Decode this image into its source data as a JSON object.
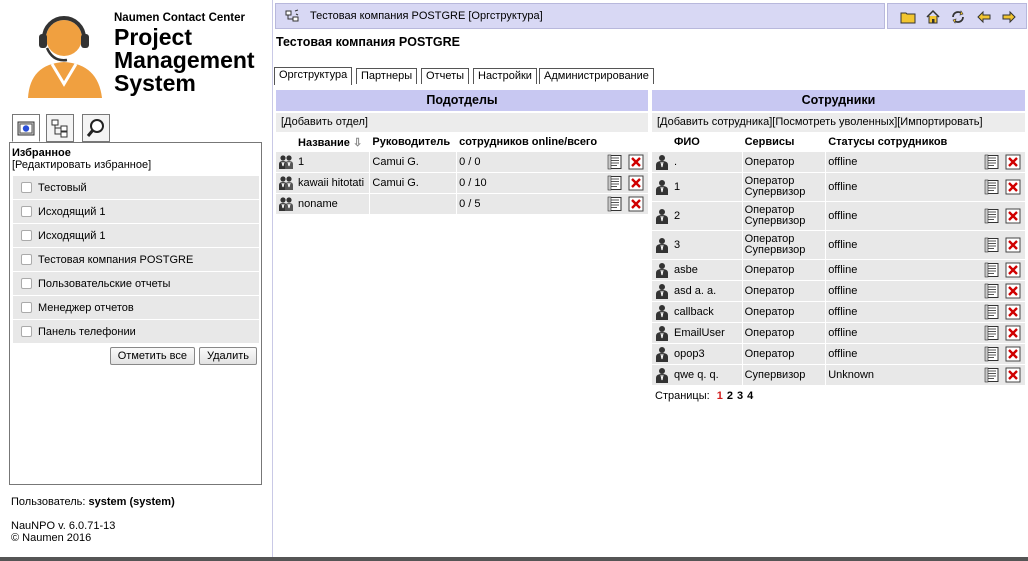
{
  "logo": {
    "company": "Naumen Contact Center",
    "product_line1": "Project",
    "product_line2": "Management",
    "product_line3": "System"
  },
  "favorites": {
    "title": "Избранное",
    "edit_link": "[Редактировать избранное]",
    "items": [
      {
        "label": "Тестовый"
      },
      {
        "label": "Исходящий 1"
      },
      {
        "label": "Исходящий 1"
      },
      {
        "label": "Тестовая компания POSTGRE"
      },
      {
        "label": "Пользовательские отчеты"
      },
      {
        "label": "Менеджер отчетов"
      },
      {
        "label": "Панель телефонии"
      }
    ],
    "mark_all_button": "Отметить все",
    "delete_button": "Удалить"
  },
  "user": {
    "label": "Пользователь:",
    "name": "system (system)"
  },
  "version": {
    "line1": "NauNPO v. 6.0.71-13",
    "line2": "© Naumen 2016"
  },
  "breadcrumb": "Тестовая компания POSTGRE [Оргструктура]",
  "page_title": "Тестовая компания POSTGRE",
  "tabs": [
    {
      "label": "Оргструктура"
    },
    {
      "label": "Партнеры"
    },
    {
      "label": "Отчеты"
    },
    {
      "label": "Настройки"
    },
    {
      "label": "Администрирование"
    }
  ],
  "subdivisions": {
    "title": "Подотделы",
    "add_link": "[Добавить отдел]",
    "columns": [
      "Название",
      "Руководитель",
      "сотрудников online/всего"
    ],
    "rows": [
      {
        "name": "1",
        "head": "Camui G.",
        "count": "0 / 0"
      },
      {
        "name": "kawaii hitotati",
        "head": "Camui G.",
        "count": "0 / 10"
      },
      {
        "name": "noname",
        "head": "",
        "count": "0 / 5"
      }
    ]
  },
  "employees": {
    "title": "Сотрудники",
    "tools_link": "[Добавить сотрудника][Посмотреть уволенных][Импортировать]",
    "columns": [
      "ФИО",
      "Сервисы",
      "Статусы сотрудников"
    ],
    "rows": [
      {
        "name": ".",
        "services1": "Оператор",
        "services2": "",
        "status": "offline"
      },
      {
        "name": "1",
        "services1": "Оператор",
        "services2": "Супервизор",
        "status": "offline"
      },
      {
        "name": "2",
        "services1": "Оператор",
        "services2": "Супервизор",
        "status": "offline"
      },
      {
        "name": "3",
        "services1": "Оператор",
        "services2": "Супервизор",
        "status": "offline"
      },
      {
        "name": "asbe",
        "services1": "Оператор",
        "services2": "",
        "status": "offline"
      },
      {
        "name": "asd a. a.",
        "services1": "Оператор",
        "services2": "",
        "status": "offline"
      },
      {
        "name": "callback",
        "services1": "Оператор",
        "services2": "",
        "status": "offline"
      },
      {
        "name": "EmailUser",
        "services1": "Оператор",
        "services2": "",
        "status": "offline"
      },
      {
        "name": "opop3",
        "services1": "Оператор",
        "services2": "",
        "status": "offline"
      },
      {
        "name": "qwe q. q.",
        "services1": "Супервизор",
        "services2": "",
        "status": "Unknown"
      }
    ],
    "pages_label": "Страницы:",
    "pages": [
      "1",
      "2",
      "3",
      "4"
    ],
    "current_page": "1"
  },
  "colors": {
    "panel_header": "#c8c8f2",
    "topbar": "#d8d8f4",
    "current_page": "#d21c1c",
    "delete_icon": "#d00000"
  }
}
